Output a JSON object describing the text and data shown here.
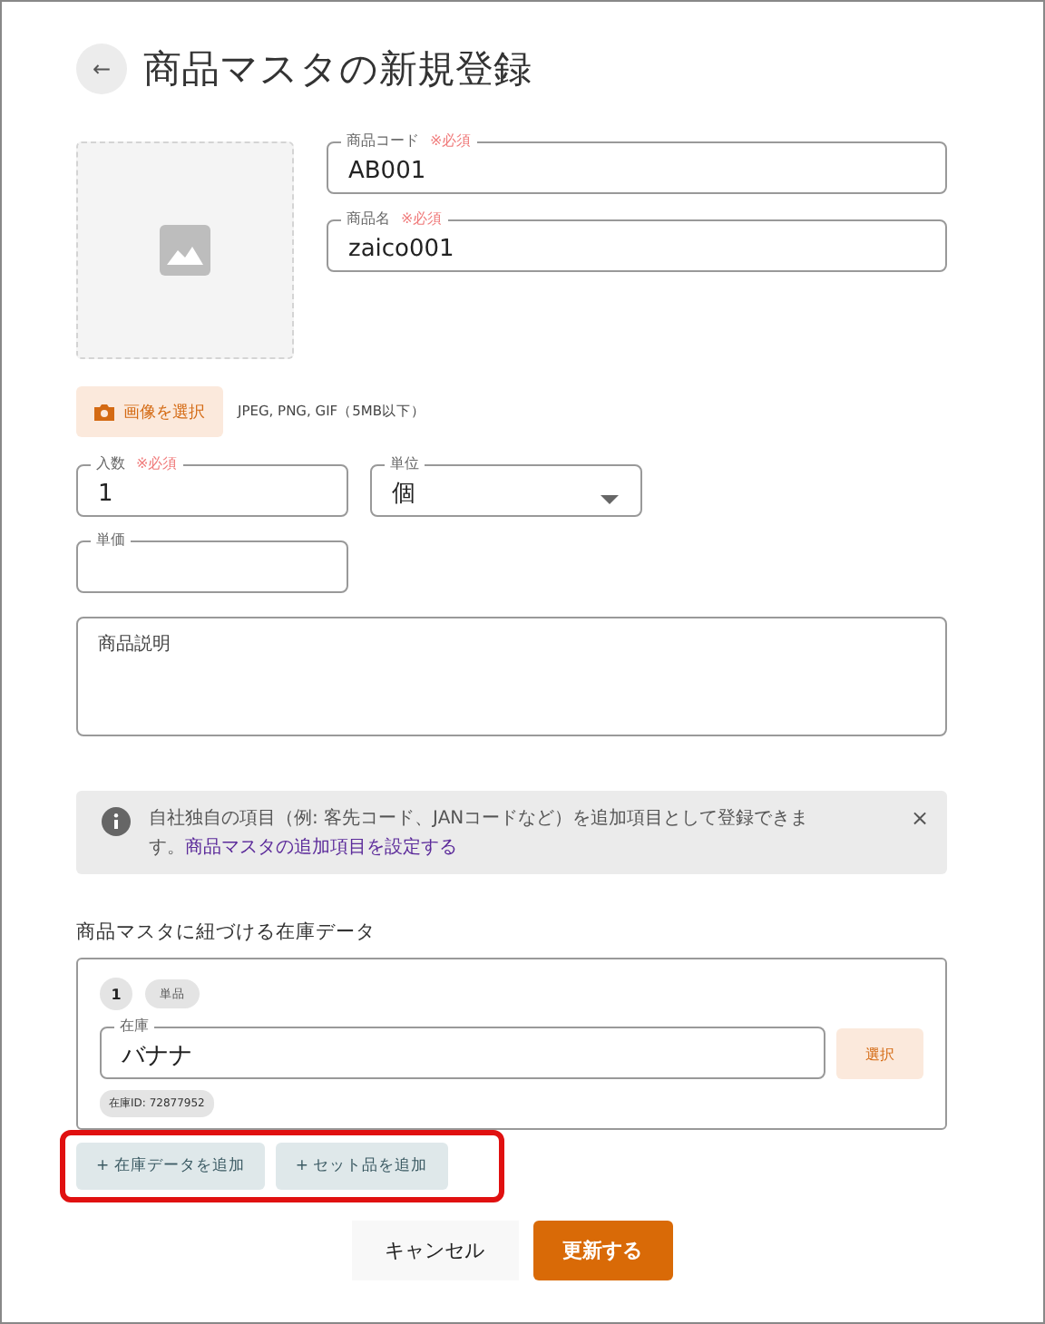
{
  "header": {
    "back_icon": "←",
    "title": "商品マスタの新規登録"
  },
  "image": {
    "button": "画像を選択",
    "note": "JPEG, PNG, GIF（5MB以下）"
  },
  "fields": [
    {
      "label": "商品コード",
      "required_text": "※必須",
      "value": "AB001"
    },
    {
      "label": "商品名",
      "required_text": "※必須",
      "value": "zaico001"
    }
  ],
  "quantity_fields": [
    {
      "label": "入数",
      "required_text": "※必須",
      "value": "1",
      "kind": "text"
    },
    {
      "label": "単位",
      "value": "個",
      "kind": "select"
    },
    {
      "label": "単価",
      "kind": "text"
    }
  ],
  "description": {
    "placeholder": "商品説明"
  },
  "alert": {
    "text": "自社独自の項目（例: 客先コード、JANコードなど）を追加項目として登録できます。",
    "link": "商品マスタの追加項目を設定する",
    "close": "×"
  },
  "stock_section": {
    "title": "商品マスタに紐づける在庫データ",
    "items": [
      {
        "number": "1",
        "type_tag": "単品",
        "label": "在庫",
        "value": "バナナ",
        "select_button": "選択",
        "id_tag": "在庫ID: 72877952"
      }
    ],
    "add_buttons": [
      "+ 在庫データを追加",
      "+ セット品を追加"
    ],
    "highlighted": true
  },
  "actions": {
    "cancel": "キャンセル",
    "submit": "更新する"
  }
}
